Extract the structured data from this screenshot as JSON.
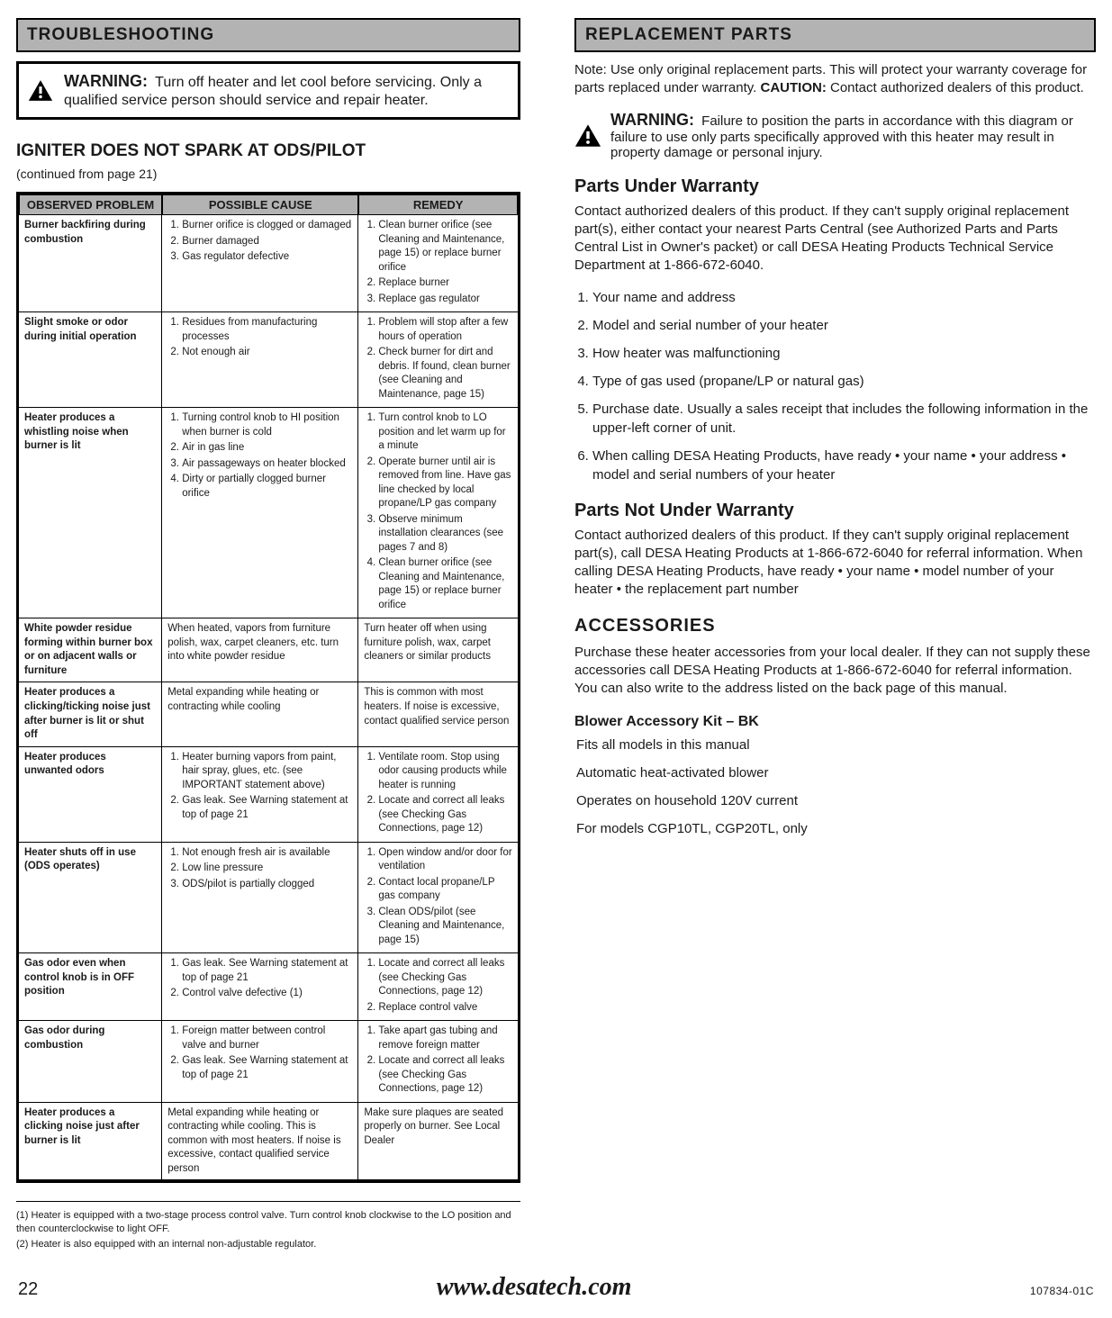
{
  "left": {
    "section_title": "TROUBLESHOOTING",
    "warn_label": "WARNING:",
    "warn_text": "Turn off heater and let cool before servicing. Only a qualified service person should service and repair heater.",
    "table_heading": "IGNITER DOES NOT SPARK AT ODS/PILOT",
    "table_subnote": "(continued from page 21)",
    "table": {
      "headers": [
        "OBSERVED PROBLEM",
        "POSSIBLE CAUSE",
        "REMEDY"
      ],
      "rows": [
        {
          "problem": "Burner backfiring during combustion",
          "causes": [
            "Burner orifice is clogged or damaged",
            "Burner damaged",
            "Gas regulator defective"
          ],
          "remedies": [
            "Clean burner orifice (see Cleaning and Maintenance, page 15) or replace burner orifice",
            "Replace burner",
            "Replace gas regulator"
          ]
        },
        {
          "problem": "Slight smoke or odor during initial operation",
          "causes": [
            "Residues from manufacturing processes",
            "Not enough air"
          ],
          "remedies": [
            "Problem will stop after a few hours of operation",
            "Check burner for dirt and debris. If found, clean burner (see Cleaning and Maintenance, page 15)"
          ]
        },
        {
          "problem": "Heater produces a whistling noise when burner is lit",
          "causes": [
            "Turning control knob to HI position when burner is cold",
            "Air in gas line",
            "Air passageways on heater blocked",
            "Dirty or partially clogged burner orifice"
          ],
          "remedies": [
            "Turn control knob to LO position and let warm up for a minute",
            "Operate burner until air is removed from line. Have gas line checked by local propane/LP gas company",
            "Observe minimum installation clearances (see pages 7 and 8)",
            "Clean burner orifice (see Cleaning and Maintenance, page 15) or replace burner orifice"
          ]
        },
        {
          "problem": "White powder residue forming within burner box or on adjacent walls or furniture",
          "causes": [
            "When heated, vapors from furniture polish, wax, carpet cleaners, etc. turn into white powder residue"
          ],
          "remedies": [
            "Turn heater off when using furniture polish, wax, carpet cleaners or similar products"
          ]
        },
        {
          "problem": "Heater produces a clicking/ticking noise just after burner is lit or shut off",
          "causes": [
            "Metal expanding while heating or contracting while cooling"
          ],
          "remedies": [
            "This is common with most heaters. If noise is excessive, contact qualified service person"
          ]
        },
        {
          "problem": "Heater produces unwanted odors",
          "causes": [
            "Heater burning vapors from paint, hair spray, glues, etc. (see IMPORTANT statement above)",
            "Gas leak. See Warning statement at top of page 21"
          ],
          "remedies": [
            "Ventilate room. Stop using odor causing products while heater is running",
            "Locate and correct all leaks (see Checking Gas Connections, page 12)"
          ]
        },
        {
          "problem": "Heater shuts off in use (ODS operates)",
          "causes": [
            "Not enough fresh air is available",
            "Low line pressure",
            "ODS/pilot is partially clogged"
          ],
          "remedies": [
            "Open window and/or door for ventilation",
            "Contact local propane/LP gas company",
            "Clean ODS/pilot (see Cleaning and Maintenance, page 15)"
          ]
        },
        {
          "problem": "Gas odor even when control knob is in OFF position",
          "causes": [
            "Gas leak. See Warning statement at top of page 21",
            "Control valve defective (1)"
          ],
          "remedies": [
            "Locate and correct all leaks (see Checking Gas Connections, page 12)",
            "Replace control valve"
          ]
        },
        {
          "problem": "Gas odor during combustion",
          "causes": [
            "Foreign matter between control valve and burner",
            "Gas leak. See Warning statement at top of page 21"
          ],
          "remedies": [
            "Take apart gas tubing and remove foreign matter",
            "Locate and correct all leaks (see Checking Gas Connections, page 12)"
          ]
        },
        {
          "problem": "Heater produces a clicking noise just after burner is lit",
          "causes": [
            "Metal expanding while heating or contracting while cooling. This is common with most heaters. If noise is excessive, contact qualified service person"
          ],
          "remedies": [
            "Make sure plaques are seated properly on burner. See Local Dealer"
          ]
        }
      ]
    },
    "footnotes": [
      "(1) Heater is equipped with a two-stage process control valve. Turn control knob clockwise to the LO position and then counterclockwise to light OFF.",
      "(2) Heater is also equipped with an internal non-adjustable regulator."
    ]
  },
  "right": {
    "section_title": "REPLACEMENT PARTS",
    "lead_parts": {
      "prefix": "Note: Use only original replacement parts. This will protect your warranty coverage for parts replaced under warranty. ",
      "bold_warning": "CAUTION:",
      "tail": " Contact authorized dealers of this product."
    },
    "inline_warn_label": "WARNING:",
    "inline_warn_text": "Failure to position the parts in accordance with this diagram or failure to use only parts specifically approved with this heater may result in property damage or personal injury.",
    "steps_title": "Parts Under Warranty",
    "steps_intro": "Contact authorized dealers of this product. If they can't supply original replacement part(s), either contact your nearest Parts Central (see Authorized Parts and Parts Central List in Owner's packet) or call DESA Heating Products Technical Service Department at 1-866-672-6040.",
    "steps": [
      "Your name and address",
      "Model and serial number of your heater",
      "How heater was malfunctioning",
      "Type of gas used (propane/LP or natural gas)",
      "Purchase date. Usually a sales receipt that includes the following information in the upper-left corner of unit.",
      "When calling DESA Heating Products, have ready • your name • your address • model and serial numbers of your heater"
    ],
    "parts_not_title": "Parts Not Under Warranty",
    "parts_not_text": "Contact authorized dealers of this product. If they can't supply original replacement part(s), call DESA Heating Products at 1-866-672-6040 for referral information. When calling DESA Heating Products, have ready • your name • model number of your heater • the replacement part number",
    "accessories_title": "ACCESSORIES",
    "accessories_lead": "Purchase these heater accessories from your local dealer. If they can not supply these accessories call DESA Heating Products at 1-866-672-6040 for referral information. You can also write to the address listed on the back page of this manual.",
    "blower_title": "Blower Accessory Kit – BK",
    "blower_bullets": [
      "Fits all models in this manual",
      "Automatic heat-activated blower",
      "Operates on household 120V current",
      "For models CGP10TL, CGP20TL, only"
    ]
  },
  "footer": {
    "page": "22",
    "model": "107834-01C",
    "brand": "www.desatech.com"
  }
}
